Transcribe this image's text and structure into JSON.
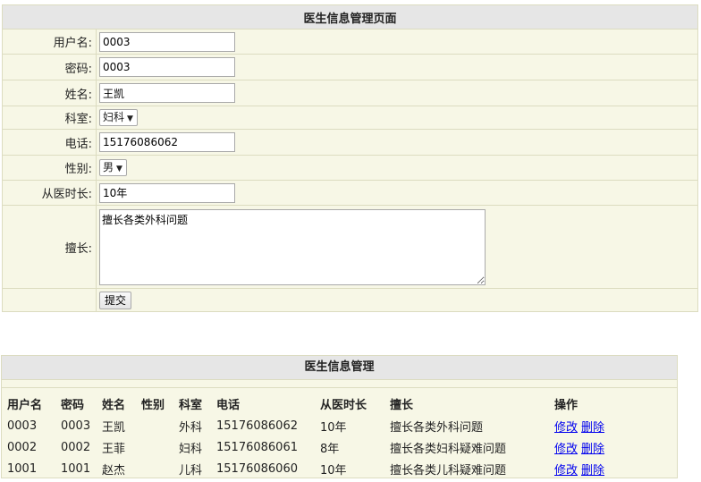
{
  "form": {
    "title": "医生信息管理页面",
    "fields": {
      "username": {
        "label": "用户名:",
        "value": "0003"
      },
      "password": {
        "label": "密码:",
        "value": "0003"
      },
      "name": {
        "label": "姓名:",
        "value": "王凯"
      },
      "department": {
        "label": "科室:",
        "value": "妇科"
      },
      "phone": {
        "label": "电话:",
        "value": "15176086062"
      },
      "gender": {
        "label": "性别:",
        "value": "男"
      },
      "years": {
        "label": "从医时长:",
        "value": "10年"
      },
      "specialty": {
        "label": "擅长:",
        "value": "擅长各类外科问题"
      }
    },
    "submit_label": "提交"
  },
  "list": {
    "title": "医生信息管理",
    "headers": [
      "用户名",
      "密码",
      "姓名",
      "性别",
      "科室",
      "电话",
      "从医时长",
      "擅长",
      "操作"
    ],
    "rows": [
      {
        "username": "0003",
        "password": "0003",
        "name": "王凯",
        "gender": "",
        "department": "外科",
        "phone": "15176086062",
        "years": "10年",
        "specialty": "擅长各类外科问题",
        "edit": "修改",
        "delete": "删除"
      },
      {
        "username": "0002",
        "password": "0002",
        "name": "王菲",
        "gender": "",
        "department": "妇科",
        "phone": "15176086061",
        "years": "8年",
        "specialty": "擅长各类妇科疑难问题",
        "edit": "修改",
        "delete": "删除"
      },
      {
        "username": "1001",
        "password": "1001",
        "name": "赵杰",
        "gender": "",
        "department": "儿科",
        "phone": "15176086060",
        "years": "10年",
        "specialty": "擅长各类儿科疑难问题",
        "edit": "修改",
        "delete": "删除"
      }
    ]
  },
  "colors": {
    "panel_bg": "#f7f7e6",
    "header_bg": "#e6e6e6",
    "border": "#dcdcc0",
    "link": "#0000ee"
  }
}
